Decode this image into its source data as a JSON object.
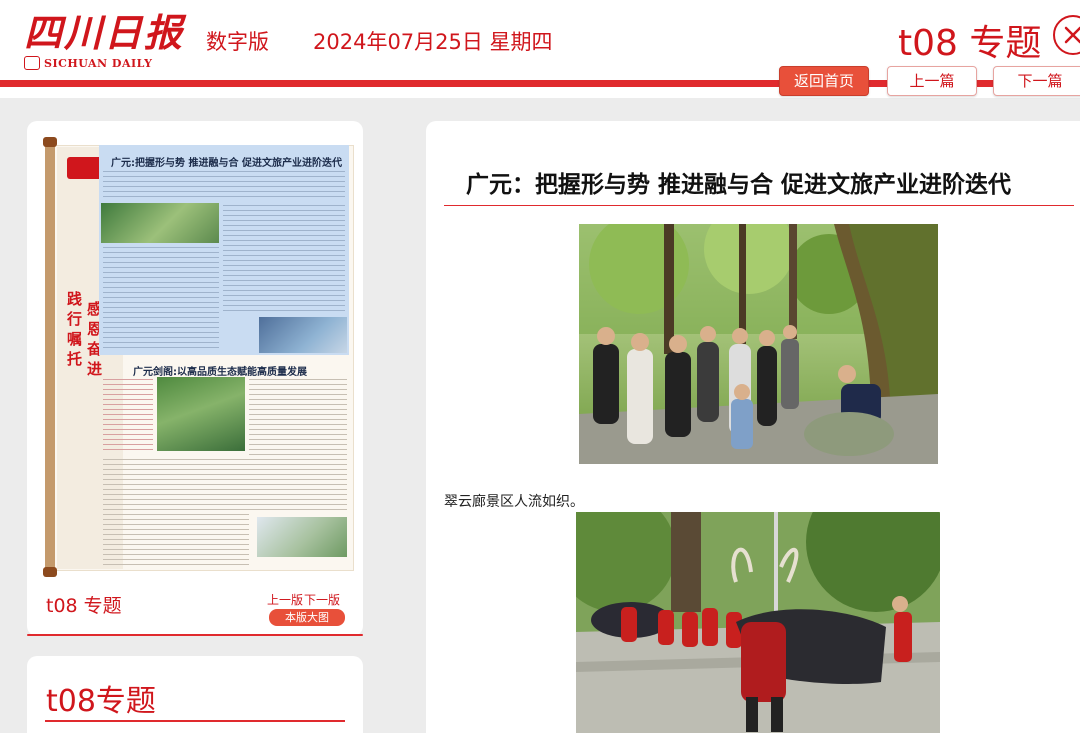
{
  "header": {
    "logo_cn": "四川日报",
    "logo_en": "SICHUAN DAILY",
    "edition": "数字版",
    "date": "2024年07月25日 星期四",
    "page_title": "t08 专题",
    "nav": {
      "home": "返回首页",
      "prev": "上一篇",
      "next": "下一篇"
    }
  },
  "thumbnail": {
    "top_headline": "广元:把握形与势 推进融与合 促进文旅产业进阶迭代",
    "mid_headline": "广元剑阁:以高品质生态赋能高质量发展",
    "slogan_col1": "践行嘱托",
    "slogan_col2": "感恩奋进",
    "page_label": "t08 专题",
    "prev_version": "上一版",
    "next_version": "下一版",
    "big_image_button": "本版大图"
  },
  "section": {
    "title": "t08专题"
  },
  "article": {
    "title": "广元：把握形与势 推进融与合 促进文旅产业进阶迭代",
    "photo1_caption": "翠云廊景区人流如织。"
  },
  "colors": {
    "brand_red": "#d0161c",
    "bar_red": "#e02a2e",
    "button_orange": "#e8503a",
    "background": "#ececec"
  }
}
